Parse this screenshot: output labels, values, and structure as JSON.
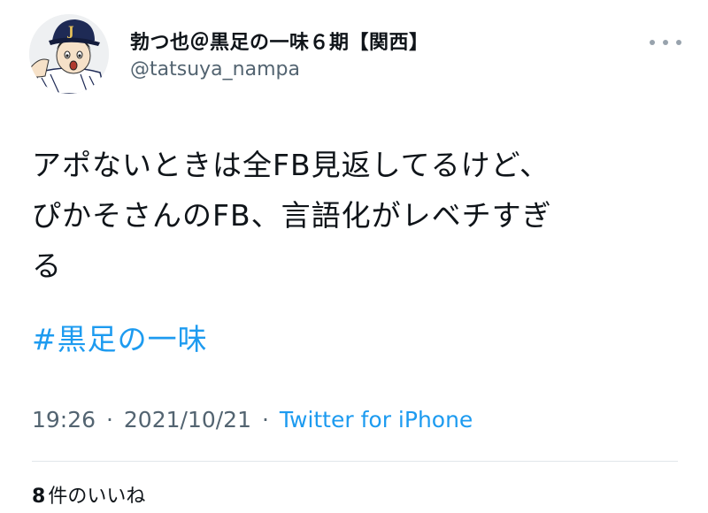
{
  "user": {
    "display_name": "勃つ也＠黒足の一味６期【関西】",
    "handle": "@tatsuya_nampa",
    "avatar_icon": "cartoon-baseball-player-avatar-icon"
  },
  "tweet": {
    "lines": [
      "アポないときは全FB見返してるけど、",
      "ぴかそさんのFB、言語化がレベチすぎ",
      "る"
    ],
    "hashtag": "#黒足の一味"
  },
  "meta": {
    "time": "19:26",
    "separator": "·",
    "date": "2021/10/21",
    "source": "Twitter for iPhone"
  },
  "likes": {
    "count": "8",
    "label": "件のいいね"
  },
  "colors": {
    "link": "#1d9bf0",
    "secondary_text": "#536471",
    "divider": "#e1e6ea"
  },
  "icons": {
    "more": "more-horizontal-icon"
  }
}
